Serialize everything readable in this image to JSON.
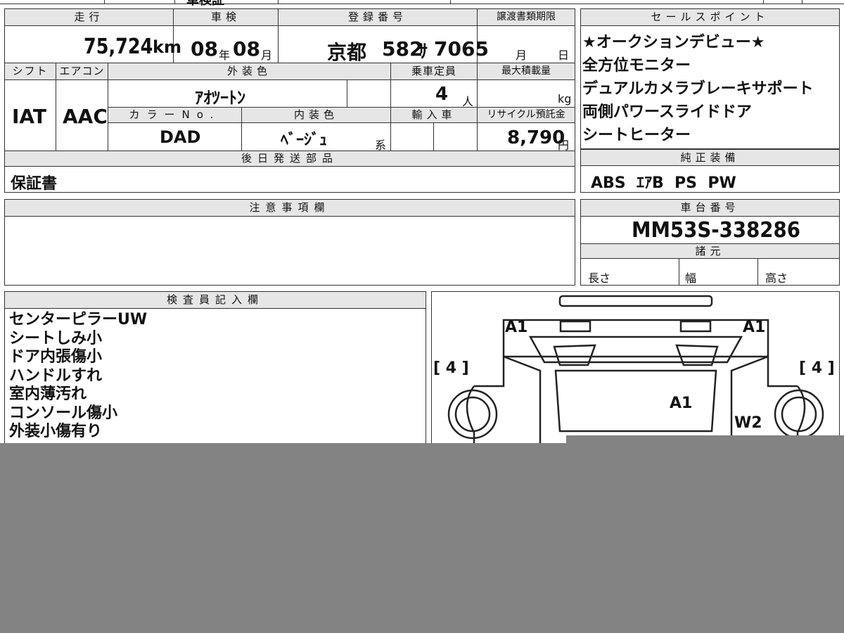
{
  "top_strip_text": "車検証",
  "main_table": {
    "mileage": {
      "label": "走行",
      "value": "75,724",
      "unit": "km"
    },
    "inspection": {
      "label": "車検",
      "year": "08",
      "year_unit": "年",
      "month": "08",
      "month_unit": "月"
    },
    "registration": {
      "label": "登録番号",
      "region": "京都",
      "number": "582",
      "kana": "ｻ",
      "serial": "7065"
    },
    "transfer_deadline": {
      "label": "譲渡書類期限",
      "month_unit": "月",
      "day_unit": "日"
    },
    "shift": {
      "label": "シフト",
      "value": "IAT"
    },
    "aircon": {
      "label": "エアコン",
      "value": "AAC"
    },
    "exterior_color": {
      "label": "外装色",
      "value": "ｱｵﾂｰﾄﾝ"
    },
    "capacity": {
      "label": "乗車定員",
      "value": "4",
      "unit": "人"
    },
    "max_load": {
      "label": "最大積載量",
      "unit": "kg"
    },
    "color_no": {
      "label": "カラーNo.",
      "value": "DAD"
    },
    "interior_color": {
      "label": "内装色",
      "value": "ﾍﾞｰｼﾞｭ",
      "suffix": "系"
    },
    "import": {
      "label": "輸入車"
    },
    "recycle_fee": {
      "label": "リサイクル預託金",
      "value": "8,790",
      "unit": "円"
    },
    "later_parts": {
      "label": "後日発送部品",
      "value": "保証書"
    },
    "notes": {
      "label": "注意事項欄"
    }
  },
  "sales_points": {
    "label": "セールスポイント",
    "items": [
      "★オークションデビュー★",
      "全方位モニター",
      "デュアルカメラブレーキサポート",
      "両側パワースライドドア",
      "シートヒーター"
    ]
  },
  "genuine_equipment": {
    "label": "純正装備",
    "value": "ABS  ｴｱB  PS  PW"
  },
  "chassis_number": {
    "label": "車台番号",
    "value": "MM53S-338286"
  },
  "specs": {
    "label": "諸元",
    "length": "長さ",
    "width": "幅",
    "height": "高さ"
  },
  "inspector_notes": {
    "label": "検査員記入欄",
    "lines": [
      "センターピラーUW",
      "シートしみ小",
      "ドア内張傷小",
      "ハンドルすれ",
      "室内薄汚れ",
      "コンソール傷小",
      "外装小傷有り"
    ]
  },
  "diagram": {
    "marks": {
      "front_left": "A1",
      "front_right": "A1",
      "hood": "A1",
      "right_side": "W2",
      "tire_left": "[ 4 ]",
      "tire_right": "[ 4 ]"
    }
  },
  "colors": {
    "header_bg": "#e6e6e6",
    "line": "#333333",
    "overlay": "#838383"
  }
}
